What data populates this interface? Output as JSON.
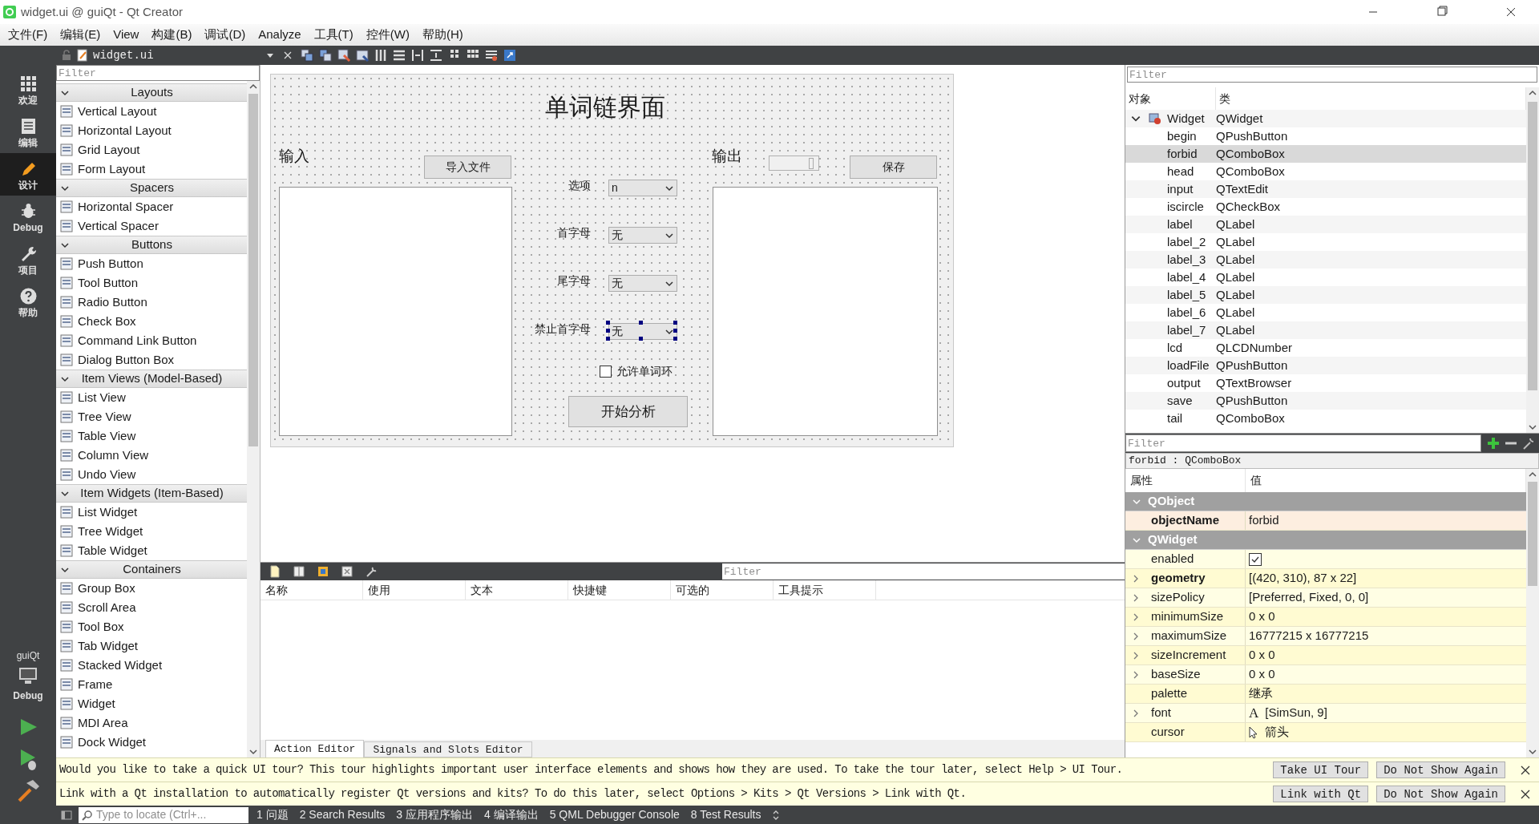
{
  "window": {
    "title": "widget.ui @ guiQt - Qt Creator"
  },
  "menu": [
    "文件(F)",
    "编辑(E)",
    "View",
    "构建(B)",
    "调试(D)",
    "Analyze",
    "工具(T)",
    "控件(W)",
    "帮助(H)"
  ],
  "modes": [
    {
      "label": "欢迎",
      "selected": false
    },
    {
      "label": "编辑",
      "selected": false
    },
    {
      "label": "设计",
      "selected": true
    },
    {
      "label": "Debug",
      "selected": false
    },
    {
      "label": "项目",
      "selected": false
    },
    {
      "label": "帮助",
      "selected": false
    }
  ],
  "kit": {
    "project": "guiQt",
    "build": "Debug"
  },
  "editor_tab": {
    "file": "widget.ui"
  },
  "widget_box": {
    "filter": {
      "placeholder": "Filter"
    },
    "categories": [
      {
        "title": "Layouts",
        "expanded": true,
        "items": [
          "Vertical Layout",
          "Horizontal Layout",
          "Grid Layout",
          "Form Layout"
        ]
      },
      {
        "title": "Spacers",
        "expanded": true,
        "items": [
          "Horizontal Spacer",
          "Vertical Spacer"
        ]
      },
      {
        "title": "Buttons",
        "expanded": true,
        "items": [
          "Push Button",
          "Tool Button",
          "Radio Button",
          "Check Box",
          "Command Link Button",
          "Dialog Button Box"
        ]
      },
      {
        "title": "Item Views (Model-Based)",
        "expanded": true,
        "items": [
          "List View",
          "Tree View",
          "Table View",
          "Column View",
          "Undo View"
        ]
      },
      {
        "title": "Item Widgets (Item-Based)",
        "expanded": true,
        "items": [
          "List Widget",
          "Tree Widget",
          "Table Widget"
        ]
      },
      {
        "title": "Containers",
        "expanded": true,
        "items": [
          "Group Box",
          "Scroll Area",
          "Tool Box",
          "Tab Widget",
          "Stacked Widget",
          "Frame",
          "Widget",
          "MDI Area",
          "Dock Widget"
        ]
      }
    ]
  },
  "form": {
    "title": "单词链界面",
    "input_label": "输入",
    "load_button": "导入文件",
    "output_label": "输出",
    "save_button": "保存",
    "start_button": "开始分析",
    "options": [
      {
        "label": "选项",
        "value": "n",
        "selected": false
      },
      {
        "label": "首字母",
        "value": "无",
        "selected": false
      },
      {
        "label": "尾字母",
        "value": "无",
        "selected": false
      },
      {
        "label": "禁止首字母",
        "value": "无",
        "selected": true
      }
    ],
    "checkbox": {
      "label": "允许单词环",
      "checked": false
    }
  },
  "action_editor": {
    "filter": {
      "placeholder": "Filter"
    },
    "columns": [
      "名称",
      "使用",
      "文本",
      "快捷键",
      "可选的",
      "工具提示"
    ],
    "tabs": [
      {
        "label": "Action Editor",
        "selected": true
      },
      {
        "label": "Signals and Slots Editor",
        "selected": false
      }
    ]
  },
  "object_inspector": {
    "filter": {
      "placeholder": "Filter"
    },
    "columns": [
      "对象",
      "类"
    ],
    "tree": [
      {
        "name": "Widget",
        "class": "QWidget",
        "selected": false,
        "expanded": true,
        "children": [
          {
            "name": "begin",
            "class": "QPushButton",
            "selected": false
          },
          {
            "name": "forbid",
            "class": "QComboBox",
            "selected": true
          },
          {
            "name": "head",
            "class": "QComboBox",
            "selected": false
          },
          {
            "name": "input",
            "class": "QTextEdit",
            "selected": false
          },
          {
            "name": "iscircle",
            "class": "QCheckBox",
            "selected": false
          },
          {
            "name": "label",
            "class": "QLabel",
            "selected": false
          },
          {
            "name": "label_2",
            "class": "QLabel",
            "selected": false
          },
          {
            "name": "label_3",
            "class": "QLabel",
            "selected": false
          },
          {
            "name": "label_4",
            "class": "QLabel",
            "selected": false
          },
          {
            "name": "label_5",
            "class": "QLabel",
            "selected": false
          },
          {
            "name": "label_6",
            "class": "QLabel",
            "selected": false
          },
          {
            "name": "label_7",
            "class": "QLabel",
            "selected": false
          },
          {
            "name": "lcd",
            "class": "QLCDNumber",
            "selected": false
          },
          {
            "name": "loadFile",
            "class": "QPushButton",
            "selected": false
          },
          {
            "name": "output",
            "class": "QTextBrowser",
            "selected": false
          },
          {
            "name": "save",
            "class": "QPushButton",
            "selected": false
          },
          {
            "name": "tail",
            "class": "QComboBox",
            "selected": false
          }
        ]
      }
    ]
  },
  "property_editor": {
    "filter": {
      "placeholder": "Filter"
    },
    "object": "forbid : QComboBox",
    "columns": [
      "属性",
      "值"
    ],
    "groups": [
      {
        "name": "QObject",
        "expanded": true,
        "properties": [
          {
            "name": "objectName",
            "kind": "text",
            "value": "forbid",
            "changed": true,
            "expandable": false
          }
        ]
      },
      {
        "name": "QWidget",
        "expanded": true,
        "properties": [
          {
            "name": "enabled",
            "kind": "checkbox",
            "checked": true,
            "changed": false,
            "expandable": false
          },
          {
            "name": "geometry",
            "kind": "text",
            "value": "[(420, 310), 87 x 22]",
            "changed": true,
            "expandable": true
          },
          {
            "name": "sizePolicy",
            "kind": "text",
            "value": "[Preferred, Fixed, 0, 0]",
            "changed": false,
            "expandable": true
          },
          {
            "name": "minimumSize",
            "kind": "text",
            "value": "0 x 0",
            "changed": false,
            "expandable": true
          },
          {
            "name": "maximumSize",
            "kind": "text",
            "value": "16777215 x 16777215",
            "changed": false,
            "expandable": true
          },
          {
            "name": "sizeIncrement",
            "kind": "text",
            "value": "0 x 0",
            "changed": false,
            "expandable": true
          },
          {
            "name": "baseSize",
            "kind": "text",
            "value": "0 x 0",
            "changed": false,
            "expandable": true
          },
          {
            "name": "palette",
            "kind": "text",
            "value": "继承",
            "changed": false,
            "expandable": false
          },
          {
            "name": "font",
            "kind": "font",
            "glyph": "A",
            "value": "[SimSun, 9]",
            "changed": false,
            "expandable": true
          },
          {
            "name": "cursor",
            "kind": "cursor",
            "value": "箭头",
            "changed": false,
            "expandable": false
          }
        ]
      }
    ]
  },
  "notifications": [
    {
      "text": "Would you like to take a quick UI tour? This tour highlights important user interface elements and shows how they are used. To take the tour later, select Help > UI Tour.",
      "buttons": [
        "Take UI Tour",
        "Do Not Show Again"
      ]
    },
    {
      "text": "Link with a Qt installation to automatically register Qt versions and kits? To do this later, select Options > Kits > Qt Versions > Link with Qt.",
      "buttons": [
        "Link with Qt",
        "Do Not Show Again"
      ]
    }
  ],
  "status_bar": {
    "locate": {
      "placeholder": "Type to locate (Ctrl+..."
    },
    "panes": [
      "1 问题",
      "2 Search Results",
      "3 应用程序输出",
      "4 编译输出",
      "5 QML Debugger Console",
      "8 Test Results"
    ]
  }
}
